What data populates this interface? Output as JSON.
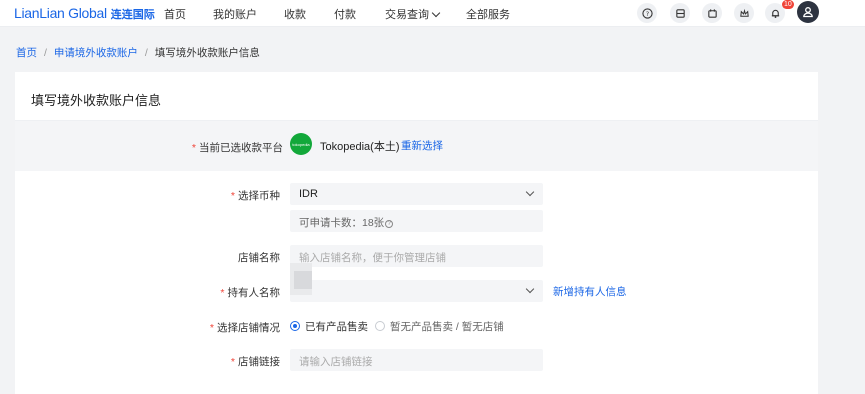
{
  "header": {
    "logo_en": "LianLian Global",
    "logo_cn": "连连国际",
    "nav": [
      {
        "label": "首页"
      },
      {
        "label": "我的账户"
      },
      {
        "label": "收款"
      },
      {
        "label": "付款"
      },
      {
        "label": "交易查询"
      },
      {
        "label": "全部服务"
      }
    ],
    "notification_count": "10"
  },
  "breadcrumb": {
    "home": "首页",
    "sep": "/",
    "parent": "申请境外收款账户",
    "current": "填写境外收款账户信息"
  },
  "form": {
    "title": "填写境外收款账户信息",
    "platform": {
      "label": "当前已选收款平台",
      "name": "Tokopedia(本土)",
      "logo_text": "tokopedia",
      "reselect": "重新选择"
    },
    "currency": {
      "label": "选择币种",
      "value": "IDR",
      "hint": "可申请卡数：18张"
    },
    "shop_name": {
      "label": "店铺名称",
      "placeholder": "输入店铺名称，便于你管理店铺"
    },
    "holder": {
      "label": "持有人名称",
      "add_link": "新增持有人信息"
    },
    "shop_status": {
      "label": "选择店铺情况",
      "options": [
        {
          "label": "已有产品售卖",
          "selected": true
        },
        {
          "label": "暂无产品售卖 / 暂无店铺",
          "selected": false
        }
      ]
    },
    "shop_link": {
      "label": "店铺链接",
      "placeholder": "请输入店铺链接"
    },
    "required_mark": "*"
  },
  "colors": {
    "accent": "#1a66e6",
    "required": "#f04438",
    "platform_green": "#12a83a"
  }
}
